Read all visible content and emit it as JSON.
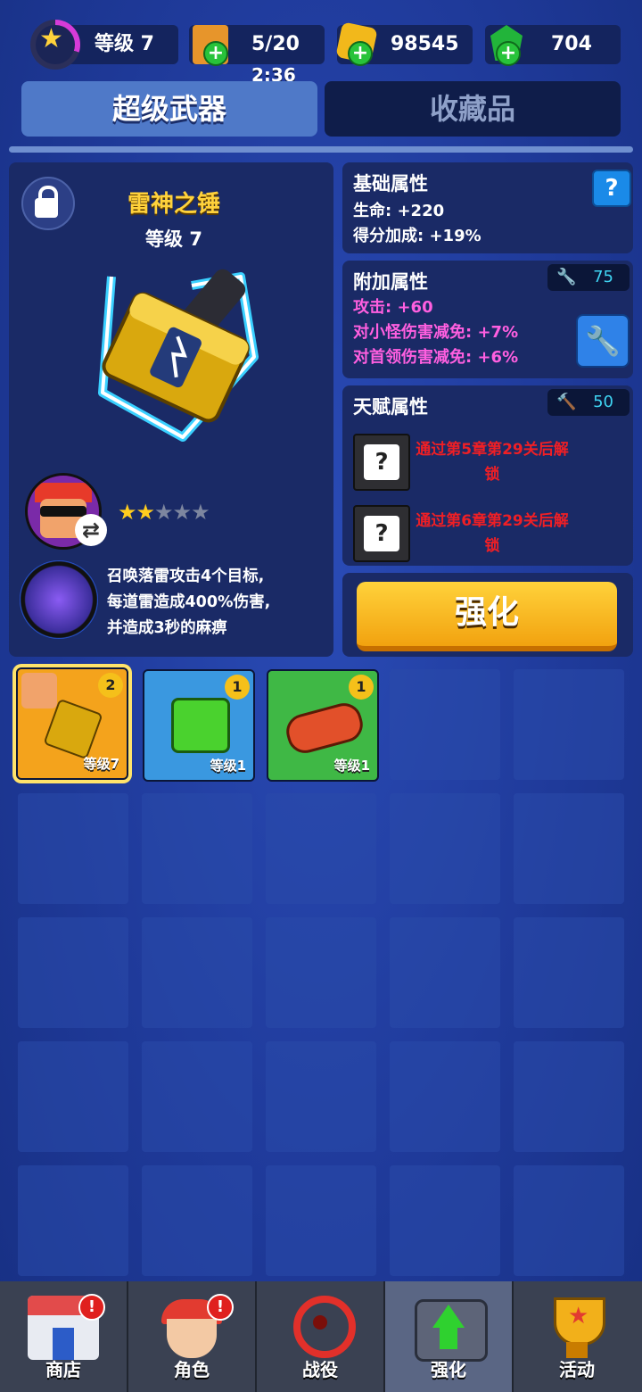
{
  "header": {
    "level_label": "等级 7",
    "energy": "5/20",
    "energy_timer": "2:36",
    "coins": "98545",
    "gems": "704"
  },
  "tabs": [
    {
      "label": "超级武器",
      "active": true
    },
    {
      "label": "收藏品",
      "active": false
    }
  ],
  "weapon": {
    "name": "雷神之锤",
    "level": "等级 7",
    "stars_filled": 2,
    "stars_total": 5,
    "skill_desc": [
      "召唤落雷攻击4个目标,",
      "每道雷造成400%伤害,",
      "并造成3秒的麻痹"
    ]
  },
  "base_attrs": {
    "title": "基础属性",
    "help": "?",
    "lines": [
      "生命: +220",
      "得分加成: +19%"
    ]
  },
  "extra_attrs": {
    "title": "附加属性",
    "badge_value": "75",
    "lines": [
      "攻击: +60",
      "对小怪伤害减免: +7%",
      "对首领伤害减免: +6%"
    ]
  },
  "talent_attrs": {
    "title": "天赋属性",
    "badge_value": "50",
    "locks": [
      {
        "line1": "通过第5章第29关后解",
        "line2": "锁"
      },
      {
        "line1": "通过第6章第29关后解",
        "line2": "锁"
      }
    ]
  },
  "upgrade_button": "强化",
  "inventory": [
    {
      "level": "等级7",
      "count": "2",
      "color": "#f4a31c"
    },
    {
      "level": "等级1",
      "count": "1",
      "color": "#3a98e0"
    },
    {
      "level": "等级1",
      "count": "1",
      "color": "#3fb845"
    }
  ],
  "nav": [
    {
      "label": "商店",
      "alert": "!"
    },
    {
      "label": "角色",
      "alert": "!"
    },
    {
      "label": "战役"
    },
    {
      "label": "强化"
    },
    {
      "label": "活动"
    }
  ],
  "colors": {
    "accent": "#ffd23b",
    "locked_text": "#ef1f25",
    "extra_text": "#ff5fe0"
  }
}
